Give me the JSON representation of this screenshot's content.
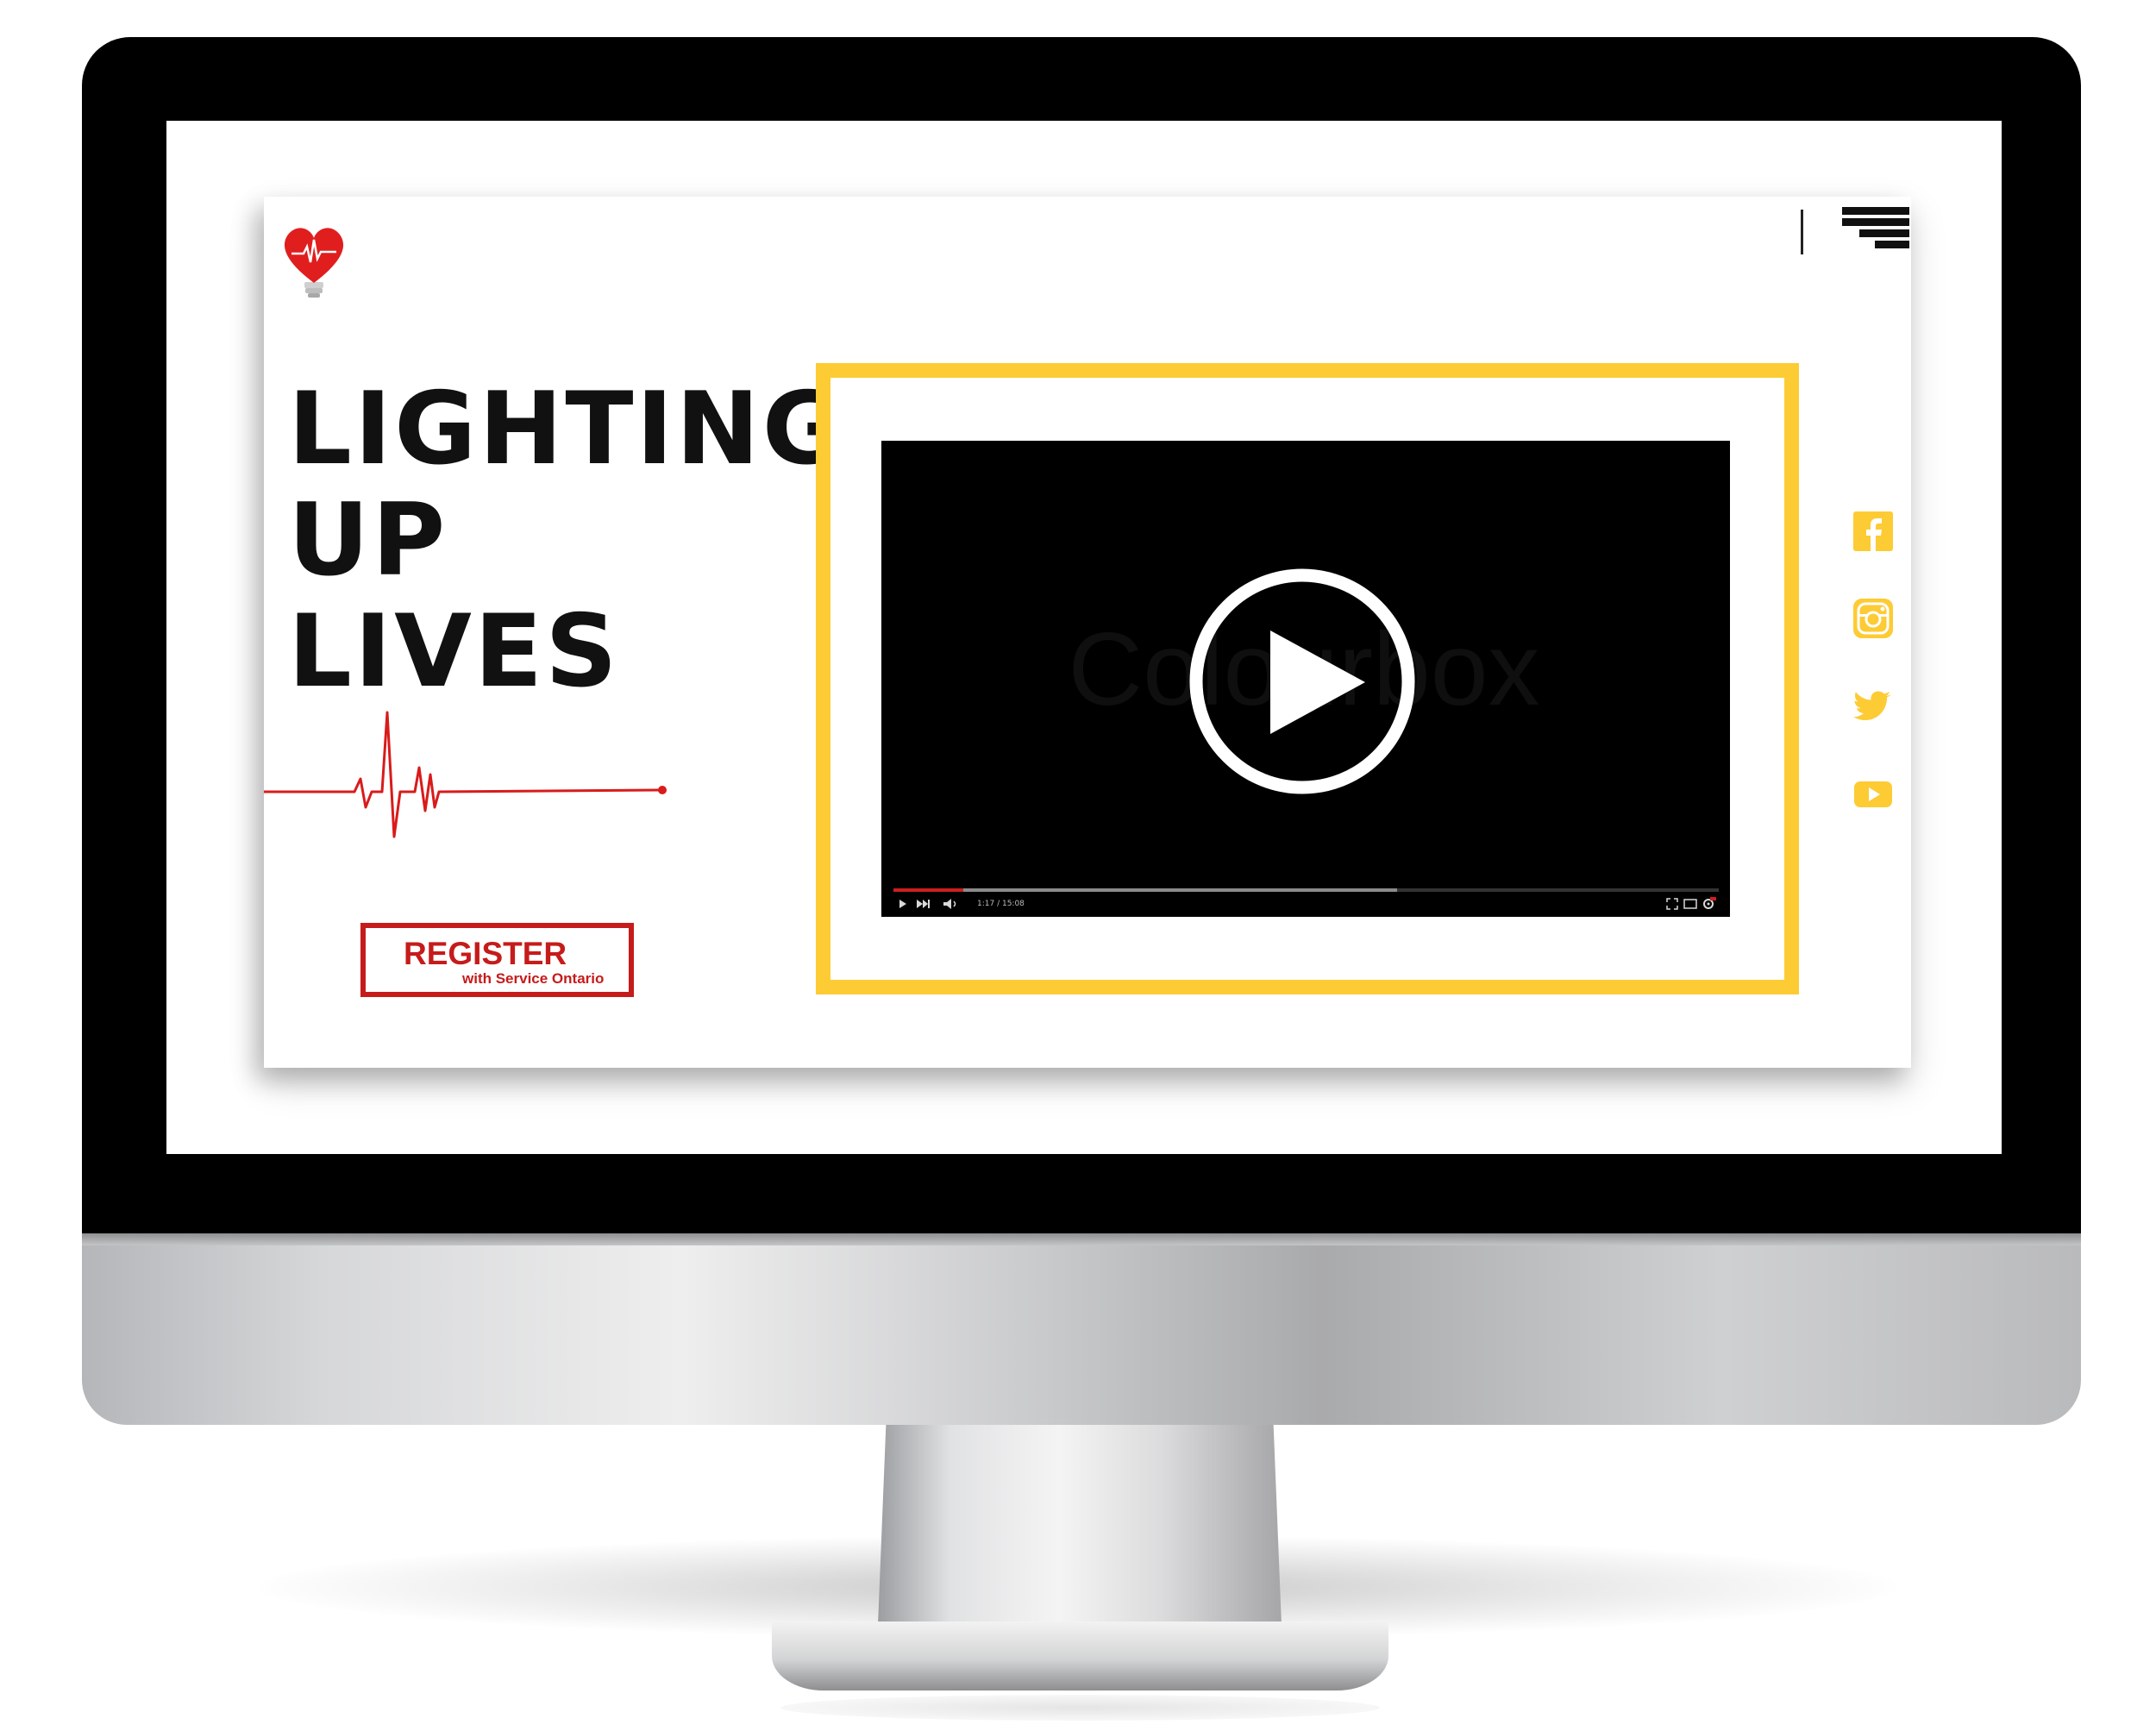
{
  "colors": {
    "accent_yellow": "#fdcb34",
    "brand_red": "#c61b1b",
    "text_dark": "#111111"
  },
  "logo": {
    "icon": "heart-bulb-logo-icon"
  },
  "header": {
    "menu_icon": "menu-icon"
  },
  "hero": {
    "title_lines": [
      "LIGHTING",
      "UP",
      "LIVES"
    ]
  },
  "register_button": {
    "label": "REGISTER",
    "sublabel": "with Service Ontario"
  },
  "video": {
    "watermark": "Colourbox",
    "current_time": "1:17 / 15:08",
    "progress_fraction": 0.085,
    "buffered_fraction": 0.61,
    "controls": [
      "play-icon",
      "next-icon",
      "volume-icon",
      "fullscreen-icon",
      "miniplayer-icon",
      "settings-icon"
    ]
  },
  "social": [
    "facebook-icon",
    "instagram-icon",
    "twitter-icon",
    "youtube-icon"
  ]
}
